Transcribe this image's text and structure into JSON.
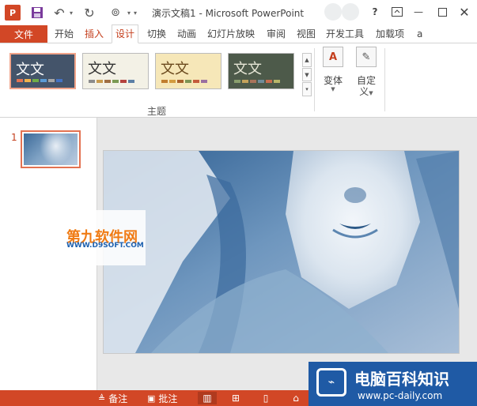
{
  "titlebar": {
    "app_icon_label": "P",
    "title": "演示文稿1 - Microsoft PowerPoint",
    "help_label": "?"
  },
  "tabs": {
    "file": "文件",
    "items": [
      "开始",
      "插入",
      "设计",
      "切换",
      "动画",
      "幻灯片放映",
      "审阅",
      "视图",
      "开发工具",
      "加载项",
      "a"
    ]
  },
  "ribbon": {
    "themes": [
      {
        "text": "文文",
        "colors": [
          "#e37252",
          "#f0b24d",
          "#70ad47",
          "#5b9bd5",
          "#a5a5a5",
          "#4472c4"
        ]
      },
      {
        "text": "文文",
        "colors": [
          "#8c8c8c",
          "#c89b4e",
          "#9f6e43",
          "#7b9a54",
          "#b5433f",
          "#5b7fa6"
        ]
      },
      {
        "text": "文文",
        "colors": [
          "#c07d2e",
          "#d39c3f",
          "#a95f2b",
          "#7c9354",
          "#c45a3b",
          "#9a6fa0"
        ]
      },
      {
        "text": "文文",
        "colors": [
          "#8a9f6e",
          "#c4a25b",
          "#a8735a",
          "#6f8c9a",
          "#c86d4f",
          "#b9b76a"
        ]
      }
    ],
    "group_label": "主题",
    "variants_label": "变体",
    "customize_label_1": "自定",
    "customize_label_2": "义",
    "variants_icon": "A",
    "customize_icon": "✎"
  },
  "thumbnails": {
    "slide_number": "1"
  },
  "watermark_left": {
    "main": "第九软件网",
    "sub": "WWW.D9SOFT.COM"
  },
  "statusbar": {
    "notes": "备注",
    "comments": "批注"
  },
  "watermark_right": {
    "main": "电脑百科知识",
    "sub": "www.pc-daily.com"
  },
  "colors": {
    "accent": "#d24726",
    "active_tab": "#c43e1c",
    "photo_tint": "#3c6a99"
  }
}
